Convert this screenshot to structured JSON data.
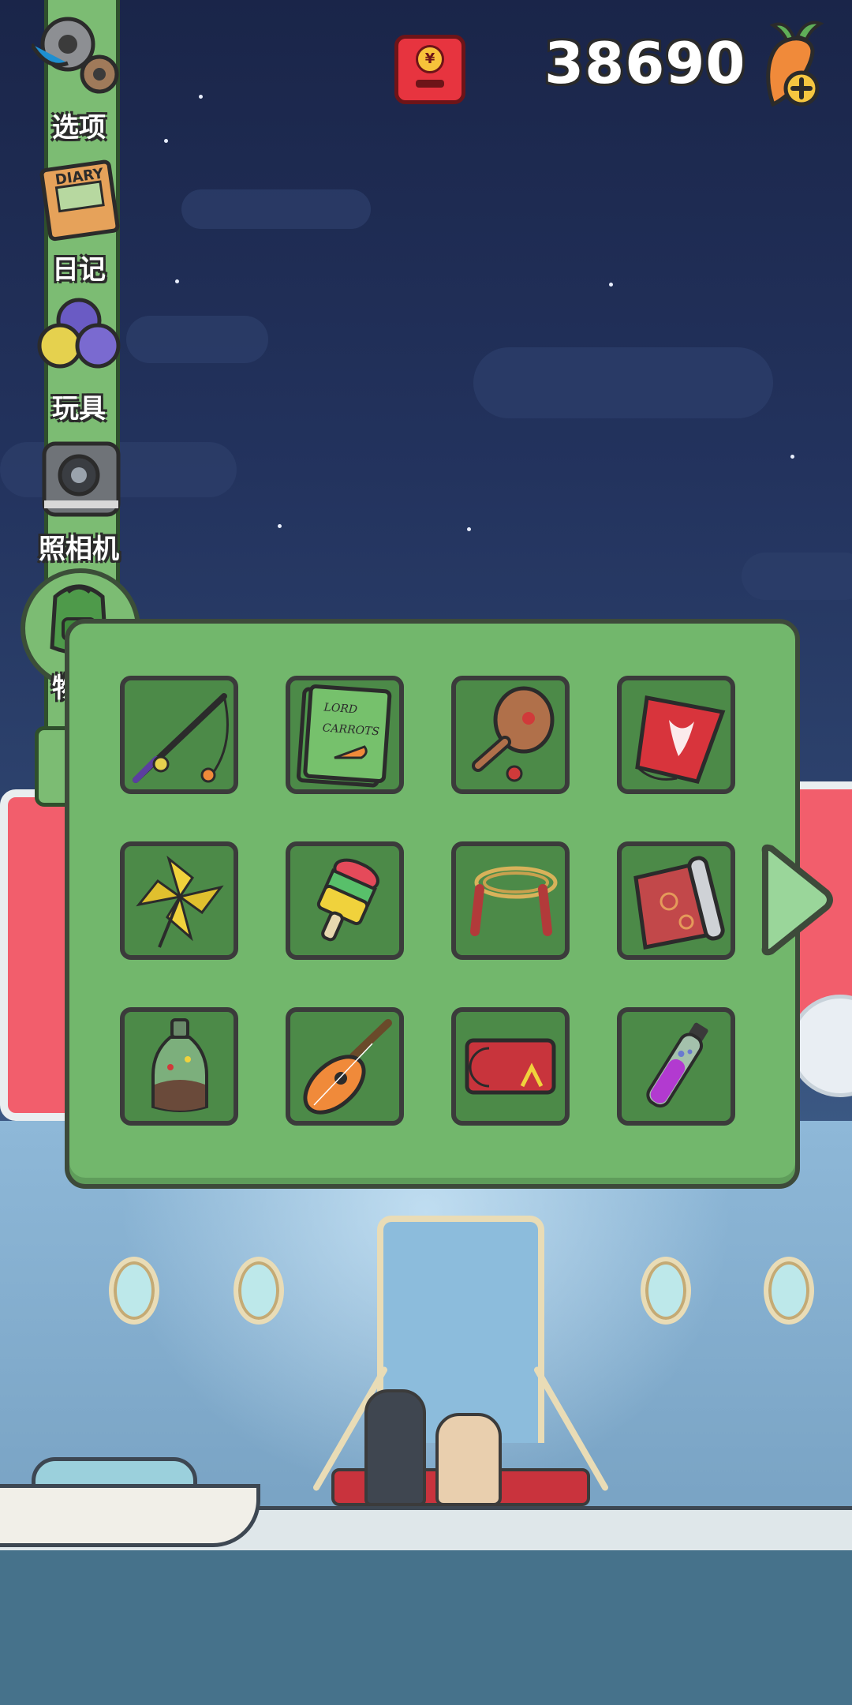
{
  "status_bar": {
    "carrot_count": "38690"
  },
  "sidebar": {
    "items": [
      {
        "label": "选项",
        "icon": "gear-icon"
      },
      {
        "label": "日记",
        "icon": "diary-icon"
      },
      {
        "label": "玩具",
        "icon": "toy-balls-icon"
      },
      {
        "label": "照相机",
        "icon": "camera-icon"
      },
      {
        "label": "物品",
        "icon": "backpack-icon"
      }
    ]
  },
  "inventory": {
    "items": [
      {
        "name": "fishing-rod",
        "icon": "fishing-rod-icon"
      },
      {
        "name": "book",
        "icon": "book-icon",
        "text": "THE LORD OF THE CARROTS"
      },
      {
        "name": "paddle-ball",
        "icon": "paddle-ball-icon"
      },
      {
        "name": "kite",
        "icon": "kite-icon"
      },
      {
        "name": "pinwheel",
        "icon": "pinwheel-icon"
      },
      {
        "name": "popsicle",
        "icon": "popsicle-icon"
      },
      {
        "name": "jump-rope",
        "icon": "jump-rope-icon"
      },
      {
        "name": "rolled-rug",
        "icon": "rug-icon"
      },
      {
        "name": "bottle-terrarium",
        "icon": "bottle-icon"
      },
      {
        "name": "ukulele",
        "icon": "ukulele-icon"
      },
      {
        "name": "moon-card",
        "icon": "card-icon"
      },
      {
        "name": "potion-vial",
        "icon": "potion-icon"
      }
    ]
  },
  "colors": {
    "panel": "#72b76c",
    "slot": "#4c8a48",
    "outline": "#3b3b3b",
    "sky": "#1a2549"
  }
}
